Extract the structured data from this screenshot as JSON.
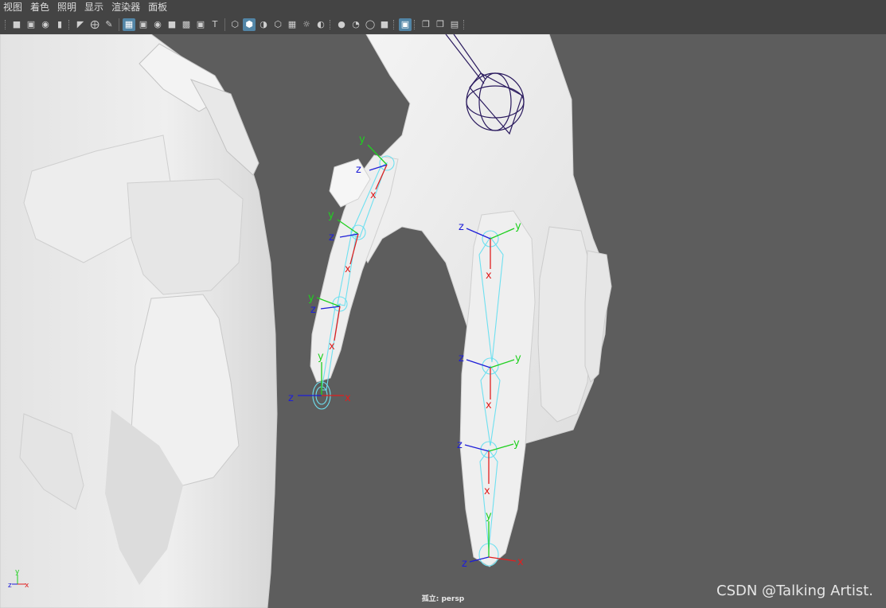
{
  "menu": [
    "视图",
    "着色",
    "照明",
    "显示",
    "渲染器",
    "面板"
  ],
  "toolbar_icons": [
    "camera-select-icon",
    "camera-lock-icon",
    "camera-attributes-icon",
    "bookmark-icon",
    "image-plane-icon",
    "2d-pan-zoom-icon",
    "grease-pencil-icon",
    "grid-icon",
    "film-gate-icon",
    "resolution-gate-icon",
    "gate-mask-icon",
    "field-chart-icon",
    "safe-action-icon",
    "safe-title-icon",
    "wireframe-icon",
    "smooth-shade-icon",
    "use-default-material-icon",
    "wireframe-on-shaded-icon",
    "textured-icon",
    "lighting-icon",
    "shadows-icon",
    "screen-space-ao-icon",
    "motion-blur-icon",
    "multisample-aa-icon",
    "depth-of-field-icon",
    "isolate-select-icon",
    "xray-icon",
    "xray-active-icon",
    "xray-joints-icon"
  ],
  "viewport": {
    "camera_label": "孤立: persp",
    "watermark": "CSDN @Talking Artist.",
    "axis_labels": {
      "x": "x",
      "y": "y",
      "z": "z"
    },
    "colors": {
      "background": "#5d5d5d",
      "mesh": "#ececec",
      "joint": "#6ee0f0",
      "x_axis": "#e02020",
      "y_axis": "#20d020",
      "z_axis": "#1e1ed8",
      "control": "#2a1a5e"
    }
  }
}
